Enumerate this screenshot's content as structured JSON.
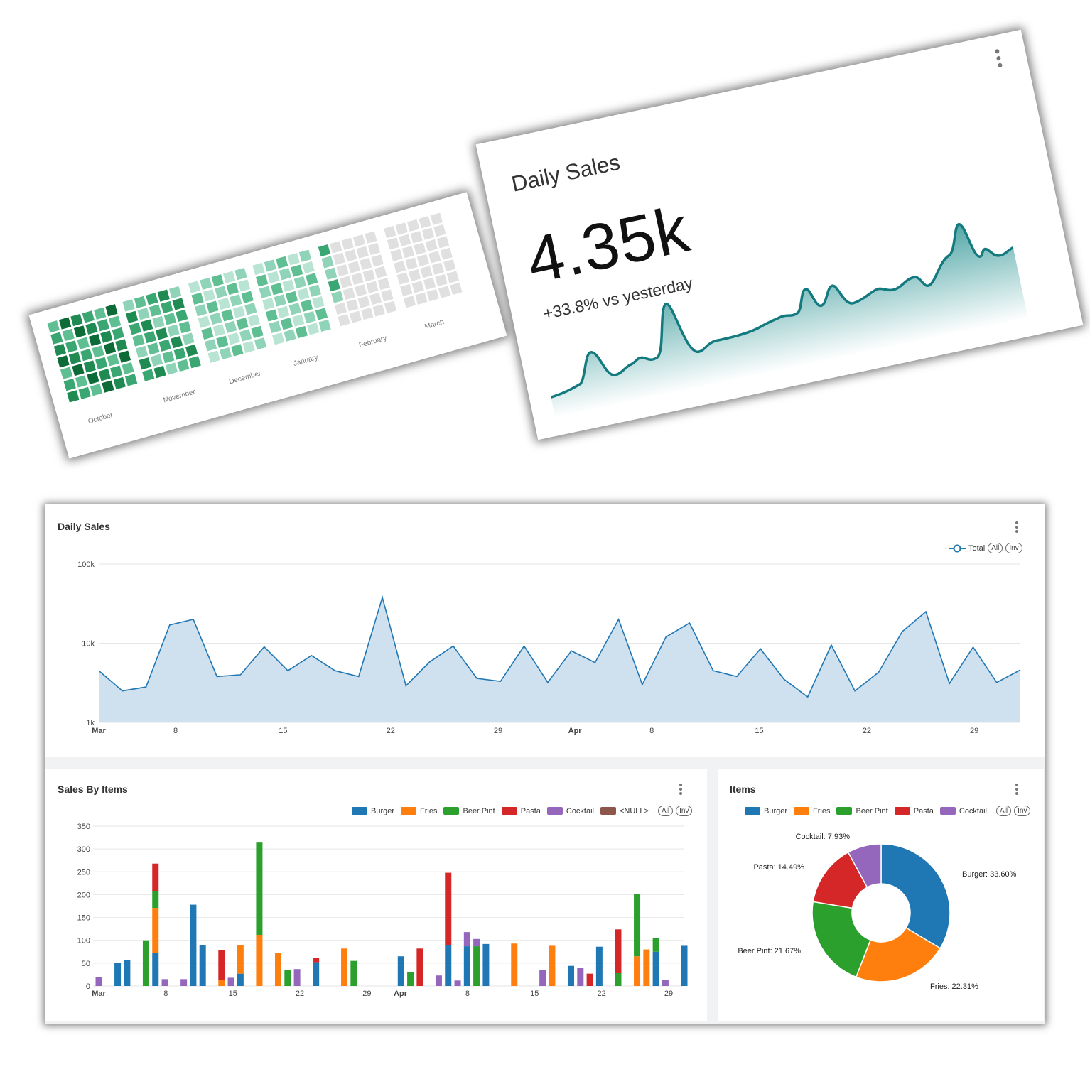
{
  "heatmap": {
    "months": [
      "October",
      "November",
      "December",
      "January",
      "February",
      "March"
    ]
  },
  "kpi_card": {
    "title": "Daily Sales",
    "value": "4.35k",
    "subtitle": "+33.8% vs yesterday"
  },
  "daily_panel": {
    "title": "Daily Sales",
    "legend": {
      "series": "Total",
      "all": "All",
      "inv": "Inv"
    }
  },
  "items_bar_panel": {
    "title": "Sales By Items",
    "legend": [
      {
        "name": "Burger",
        "color": "#1f77b4"
      },
      {
        "name": "Fries",
        "color": "#ff7f0e"
      },
      {
        "name": "Beer Pint",
        "color": "#2ca02c"
      },
      {
        "name": "Pasta",
        "color": "#d62728"
      },
      {
        "name": "Cocktail",
        "color": "#9467bd"
      },
      {
        "name": "<NULL>",
        "color": "#8c564b"
      }
    ],
    "all": "All",
    "inv": "Inv"
  },
  "items_pie_panel": {
    "title": "Items",
    "legend": [
      {
        "name": "Burger",
        "color": "#1f77b4"
      },
      {
        "name": "Fries",
        "color": "#ff7f0e"
      },
      {
        "name": "Beer Pint",
        "color": "#2ca02c"
      },
      {
        "name": "Pasta",
        "color": "#d62728"
      },
      {
        "name": "Cocktail",
        "color": "#9467bd"
      }
    ],
    "all": "All",
    "inv": "Inv"
  },
  "chart_data": [
    {
      "type": "area",
      "scale": "log",
      "ylim": [
        1000,
        100000
      ],
      "yticks": [
        "1k",
        "10k",
        "100k"
      ],
      "xticks": [
        "Mar",
        "8",
        "15",
        "22",
        "29",
        "Apr",
        "8",
        "15",
        "22",
        "29"
      ],
      "series": [
        {
          "name": "Total",
          "color": "#1f77b4"
        }
      ],
      "x_day": [
        1,
        3,
        4,
        6,
        7,
        9,
        11,
        12,
        13,
        15,
        16,
        17,
        19,
        21,
        22,
        23,
        25,
        28,
        33,
        35,
        37,
        38,
        39,
        40,
        41,
        43,
        45,
        46,
        47,
        48,
        50,
        51,
        53,
        54,
        55,
        57,
        59,
        60,
        61
      ],
      "values": [
        4500,
        2500,
        2800,
        17000,
        20000,
        3800,
        4000,
        9000,
        4500,
        7000,
        4500,
        3800,
        38000,
        2900,
        5800,
        9200,
        3600,
        3300,
        9200,
        3200,
        8000,
        5700,
        20000,
        3000,
        12000,
        18000,
        4500,
        3800,
        8500,
        3500,
        2100,
        9500,
        2500,
        4300,
        14000,
        25000,
        3100,
        8900,
        3200,
        4600
      ],
      "grid": true
    },
    {
      "type": "bar",
      "stacked": true,
      "ylim": [
        0,
        350
      ],
      "yticks": [
        "0",
        "50",
        "100",
        "150",
        "200",
        "250",
        "300",
        "350"
      ],
      "xticks": [
        "Mar",
        "8",
        "15",
        "22",
        "29",
        "Apr",
        "8",
        "15",
        "22",
        "29"
      ],
      "series_order": [
        "Burger",
        "Fries",
        "Beer Pint",
        "Pasta",
        "Cocktail"
      ],
      "bars": [
        {
          "day": 1,
          "Cocktail": 20
        },
        {
          "day": 3,
          "Burger": 50
        },
        {
          "day": 4,
          "Burger": 56
        },
        {
          "day": 6,
          "Beer Pint": 100
        },
        {
          "day": 7,
          "Burger": 73,
          "Fries": 98,
          "Beer Pint": 37,
          "Pasta": 60
        },
        {
          "day": 8,
          "Cocktail": 15
        },
        {
          "day": 10,
          "Cocktail": 15
        },
        {
          "day": 11,
          "Burger": 178
        },
        {
          "day": 12,
          "Burger": 90
        },
        {
          "day": 14,
          "Fries": 13,
          "Pasta": 66
        },
        {
          "day": 15,
          "Cocktail": 18
        },
        {
          "day": 16,
          "Burger": 27,
          "Fries": 63
        },
        {
          "day": 18,
          "Fries": 112,
          "Beer Pint": 202
        },
        {
          "day": 20,
          "Fries": 73
        },
        {
          "day": 21,
          "Beer Pint": 35
        },
        {
          "day": 22,
          "Cocktail": 37
        },
        {
          "day": 24,
          "Burger": 52,
          "Pasta": 10
        },
        {
          "day": 27,
          "Fries": 82
        },
        {
          "day": 28,
          "Beer Pint": 55
        },
        {
          "day": 33,
          "Burger": 65
        },
        {
          "day": 34,
          "Beer Pint": 30
        },
        {
          "day": 35,
          "Pasta": 82
        },
        {
          "day": 37,
          "Cocktail": 23
        },
        {
          "day": 38,
          "Burger": 90,
          "Pasta": 158
        },
        {
          "day": 39,
          "Cocktail": 12
        },
        {
          "day": 40,
          "Burger": 87,
          "Cocktail": 31
        },
        {
          "day": 41,
          "Beer Pint": 87,
          "Cocktail": 16
        },
        {
          "day": 42,
          "Burger": 92
        },
        {
          "day": 45,
          "Fries": 93
        },
        {
          "day": 48,
          "Cocktail": 35
        },
        {
          "day": 49,
          "Fries": 88
        },
        {
          "day": 51,
          "Burger": 44
        },
        {
          "day": 52,
          "Cocktail": 40
        },
        {
          "day": 53,
          "Pasta": 27
        },
        {
          "day": 54,
          "Burger": 86
        },
        {
          "day": 56,
          "Beer Pint": 28,
          "Pasta": 96
        },
        {
          "day": 58,
          "Fries": 65,
          "Beer Pint": 137
        },
        {
          "day": 59,
          "Fries": 80
        },
        {
          "day": 60,
          "Burger": 75,
          "Beer Pint": 30
        },
        {
          "day": 61,
          "Cocktail": 13
        },
        {
          "day": 63,
          "Burger": 88
        }
      ]
    },
    {
      "type": "pie",
      "donut": true,
      "slices": [
        {
          "name": "Burger",
          "value": 33.6,
          "label": "Burger: 33.60%",
          "color": "#1f77b4"
        },
        {
          "name": "Fries",
          "value": 22.31,
          "label": "Fries: 22.31%",
          "color": "#ff7f0e"
        },
        {
          "name": "Beer Pint",
          "value": 21.67,
          "label": "Beer Pint: 21.67%",
          "color": "#2ca02c"
        },
        {
          "name": "Pasta",
          "value": 14.49,
          "label": "Pasta: 14.49%",
          "color": "#d62728"
        },
        {
          "name": "Cocktail",
          "value": 7.93,
          "label": "Cocktail: 7.93%",
          "color": "#9467bd"
        }
      ]
    }
  ]
}
